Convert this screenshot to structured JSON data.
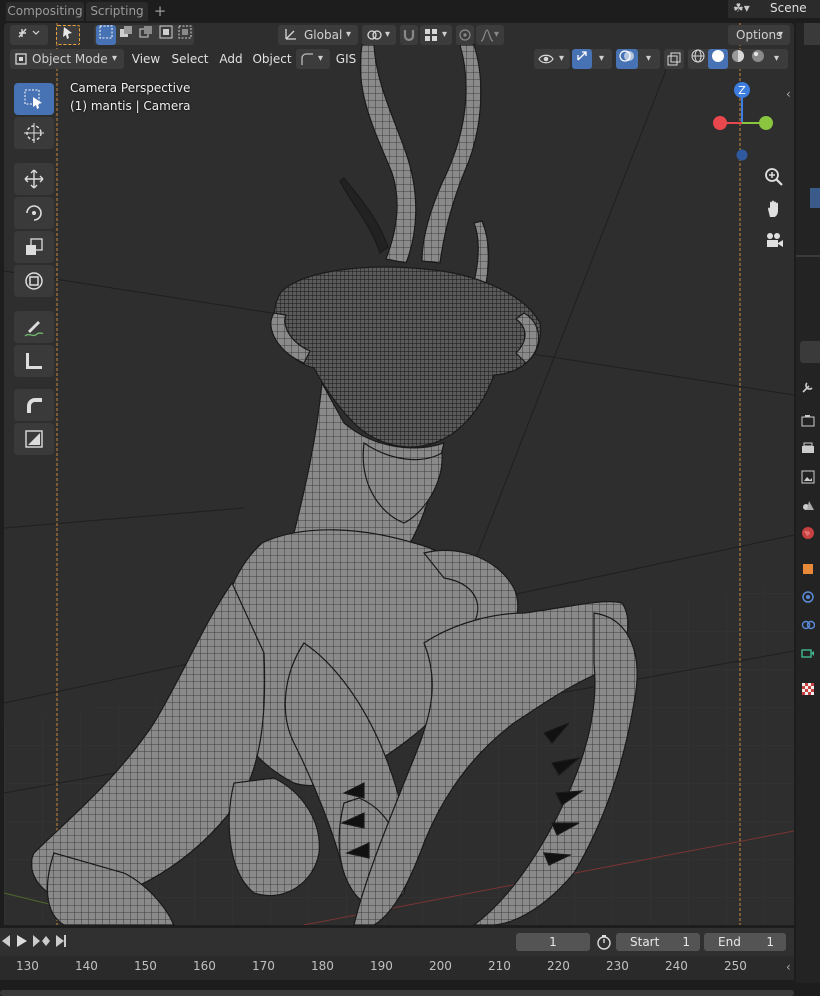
{
  "workspace_tabs": [
    "Compositing",
    "Scripting"
  ],
  "workspace_add": "+",
  "scene": {
    "label": "Scene"
  },
  "header_row1": {
    "transform_orientation": "Global",
    "options_label": "Options"
  },
  "header_row2": {
    "mode_label": "Object Mode",
    "menus": [
      "View",
      "Select",
      "Add",
      "Object",
      "GIS"
    ]
  },
  "viewport": {
    "perspective_label": "Camera Perspective",
    "object_label": "(1) mantis | Camera",
    "gizmo_axis_z": "Z"
  },
  "toolbar_tools": [
    "select-box",
    "cursor",
    "move",
    "rotate",
    "scale",
    "transform",
    "annotate",
    "measure",
    "add-cube-curve",
    "add-cube"
  ],
  "timeline": {
    "current_frame": "1",
    "start_label": "Start",
    "start_value": "1",
    "end_label": "End",
    "end_value": "1"
  },
  "ruler_ticks": [
    "130",
    "140",
    "150",
    "160",
    "170",
    "180",
    "190",
    "200",
    "210",
    "220",
    "230",
    "240",
    "250"
  ],
  "colors": {
    "accent": "#4772b3",
    "axis_x": "#e8474e",
    "axis_y": "#8ac53f",
    "axis_z": "#3d7de0"
  }
}
